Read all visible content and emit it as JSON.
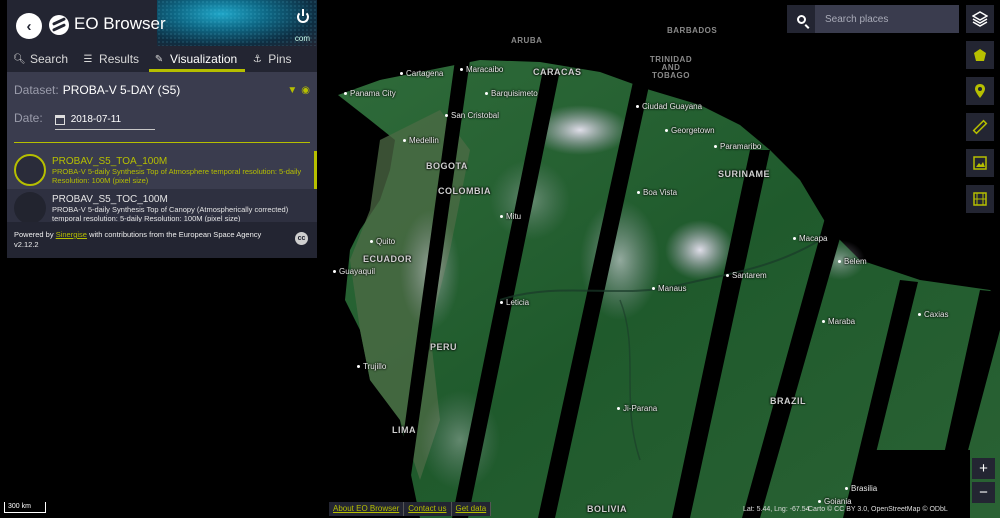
{
  "header": {
    "title": "EO Browser",
    "domain_suffix": "com"
  },
  "tabs": [
    {
      "label": "Search",
      "icon": "search-icon"
    },
    {
      "label": "Results",
      "icon": "sliders-icon"
    },
    {
      "label": "Visualization",
      "icon": "brush-icon"
    },
    {
      "label": "Pins",
      "icon": "pin-icon"
    }
  ],
  "active_tab": "Visualization",
  "visualization": {
    "dataset_label": "Dataset:",
    "dataset_value": "PROBA-V 5-DAY (S5)",
    "date_label": "Date:",
    "date_value": "2018-07-11",
    "layers": [
      {
        "name": "PROBAV_S5_TOA_100M",
        "description": "PROBA-V 5-daily Synthesis Top of Atmosphere temporal resolution: 5-daily Resolution: 100M (pixel size)"
      },
      {
        "name": "PROBAV_S5_TOC_100M",
        "description": "PROBA-V 5-daily Synthesis Top of Canopy (Atmospherically corrected) temporal resolution: 5-daily Resolution: 100M (pixel size)"
      }
    ]
  },
  "footer": {
    "powered_prefix": "Powered by",
    "powered_link": "Sinergise",
    "powered_suffix": "with contributions from the European Space Agency",
    "version": "v2.12.2"
  },
  "search": {
    "placeholder": "Search places"
  },
  "zoom": {
    "in": "+",
    "out": "−"
  },
  "scale_bar": "300 km",
  "bottom_links": [
    "About EO Browser",
    "Contact us",
    "Get data"
  ],
  "coordinates": "Lat: 5.44, Lng: -67.54",
  "attribution": "Carto © CC BY 3.0, OpenStreetMap © ODbL",
  "map_labels": {
    "aruba": "ARUBA",
    "barbados": "BARBADOS",
    "cartagena": "Cartagena",
    "maracaibo": "Maracaibo",
    "caracas": "CARACAS",
    "trinidad": "TRINIDAD AND TOBAGO",
    "panama": "Panama City",
    "barquisimeto": "Barquisimeto",
    "ciudad_guayana": "Ciudad Guayana",
    "san_cristobal": "San Cristobal",
    "georgetown": "Georgetown",
    "medellin": "Medellin",
    "paramaribo": "Paramaribo",
    "bogota": "BOGOTA",
    "boa_vista": "Boa Vista",
    "suriname": "SURINAME",
    "colombia": "COLOMBIA",
    "mitu": "Mitu",
    "macapa": "Macapa",
    "quito": "Quito",
    "belem": "Belem",
    "ecuador": "ECUADOR",
    "guayaquil": "Guayaquil",
    "manaus": "Manaus",
    "santarem": "Santarem",
    "leticia": "Leticia",
    "maraba": "Maraba",
    "caxias": "Caxias",
    "peru": "PERU",
    "trujillo": "Trujillo",
    "ji_parana": "Ji-Parana",
    "brazil": "BRAZIL",
    "lima": "LIMA",
    "brasilia": "Brasilia",
    "goiania": "Goiania",
    "bolivia": "BOLIVIA"
  }
}
